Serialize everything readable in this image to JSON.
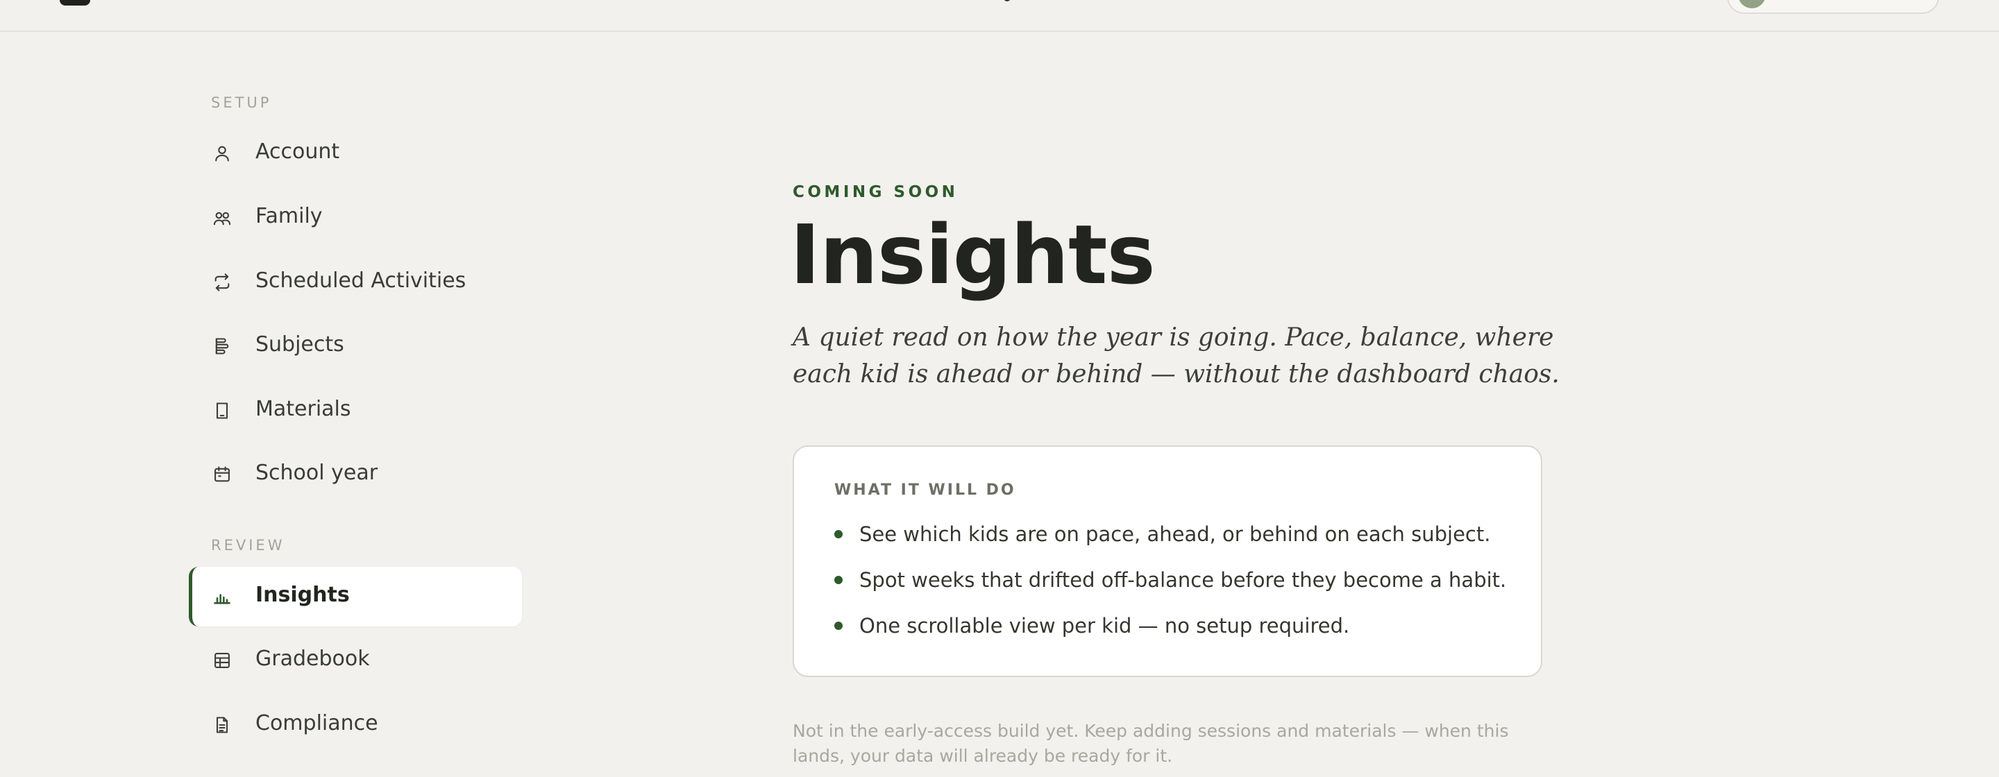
{
  "sidebar": {
    "sections": [
      {
        "label": "SETUP",
        "items": [
          {
            "label": "Account",
            "icon": "user-icon"
          },
          {
            "label": "Family",
            "icon": "users-icon"
          },
          {
            "label": "Scheduled Activities",
            "icon": "repeat-icon"
          },
          {
            "label": "Subjects",
            "icon": "subjects-icon"
          },
          {
            "label": "Materials",
            "icon": "bookmark-icon"
          },
          {
            "label": "School year",
            "icon": "calendar-icon"
          }
        ]
      },
      {
        "label": "REVIEW",
        "items": [
          {
            "label": "Insights",
            "icon": "bar-chart-icon",
            "active": true
          },
          {
            "label": "Gradebook",
            "icon": "table-icon"
          },
          {
            "label": "Compliance",
            "icon": "document-icon"
          }
        ]
      }
    ]
  },
  "main": {
    "eyebrow": "COMING SOON",
    "title": "Insights",
    "subtitle": "A quiet read on how the year is going. Pace, balance, where each kid is ahead or behind — without the dashboard chaos.",
    "card": {
      "title": "WHAT IT WILL DO",
      "bullets": [
        "See which kids are on pace, ahead, or behind on each subject.",
        "Spot weeks that drifted off-balance before they become a habit.",
        "One scrollable view per kid — no setup required."
      ]
    },
    "footnote": "Not in the early-access build yet. Keep adding sessions and materials — when this lands, your data will already be ready for it."
  },
  "colors": {
    "background": "#f2f1ed",
    "accent": "#2f5a2c",
    "card": "#ffffff"
  }
}
